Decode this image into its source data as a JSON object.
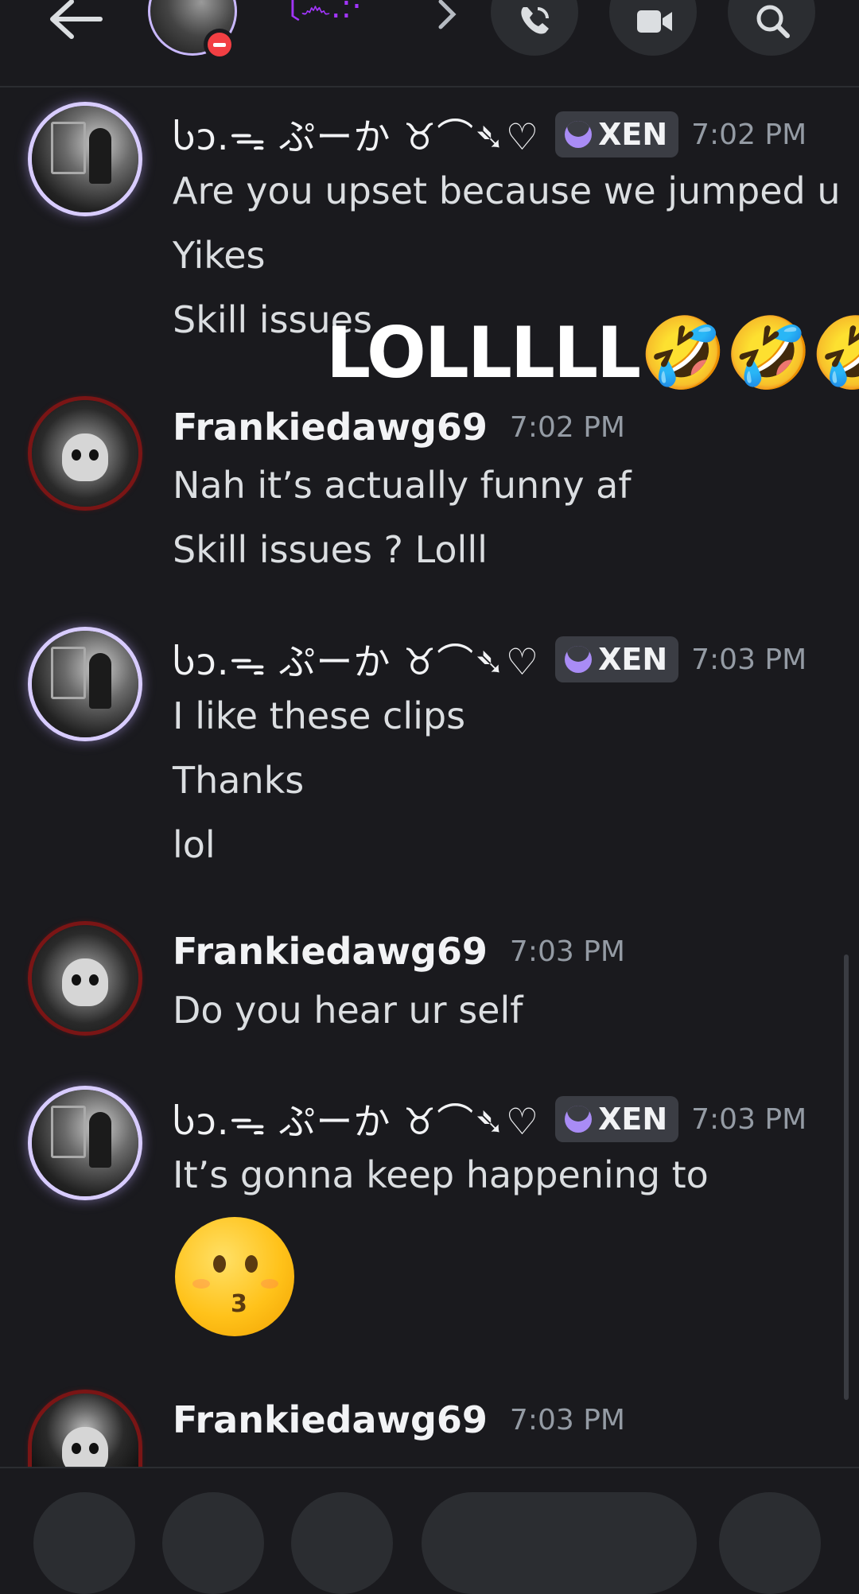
{
  "header": {
    "title": "〔෴.:‧",
    "colors": {
      "title": "#a335ff",
      "status": "#f23f43",
      "bg": "#1a1a1e"
    },
    "icons": [
      "back-arrow-icon",
      "chevron-right-icon",
      "phone-icon",
      "video-icon",
      "search-icon"
    ]
  },
  "messages": [
    {
      "author": "Ⴑɔ.ᯓ ぷーか ♉︎⌒➴♡",
      "badge": "XEN",
      "time": "7:02 PM",
      "lines": [
        "Are you upset because we jumped u",
        "Yikes",
        "Skill issues"
      ]
    },
    {
      "author": "Frankiedawg69",
      "time": "7:02 PM",
      "lines": [
        "Nah it’s actually funny af",
        "Skill issues ? Lolll"
      ]
    },
    {
      "author": "Ⴑɔ.ᯓ ぷーか ♉︎⌒➴♡",
      "badge": "XEN",
      "time": "7:03 PM",
      "lines": [
        "I like these clips",
        "Thanks",
        "lol"
      ]
    },
    {
      "author": "Frankiedawg69",
      "time": "7:03 PM",
      "lines": [
        "Do you hear ur self"
      ]
    },
    {
      "author": "Ⴑɔ.ᯓ ぷーか ♉︎⌒➴♡",
      "badge": "XEN",
      "time": "7:03 PM",
      "lines": [
        "It’s gonna keep happening to"
      ],
      "emoji": "kissing-face-emoji"
    },
    {
      "author": "Frankiedawg69",
      "time": "7:03 PM",
      "lines": []
    }
  ],
  "overlay": {
    "text": "LOLLLLL🤣🤣🤣"
  },
  "bottom_bar": {
    "icons": [
      "plus-icon",
      "apps-icon",
      "gift-icon",
      "message-input",
      "emoji-icon",
      "mic-icon"
    ]
  }
}
